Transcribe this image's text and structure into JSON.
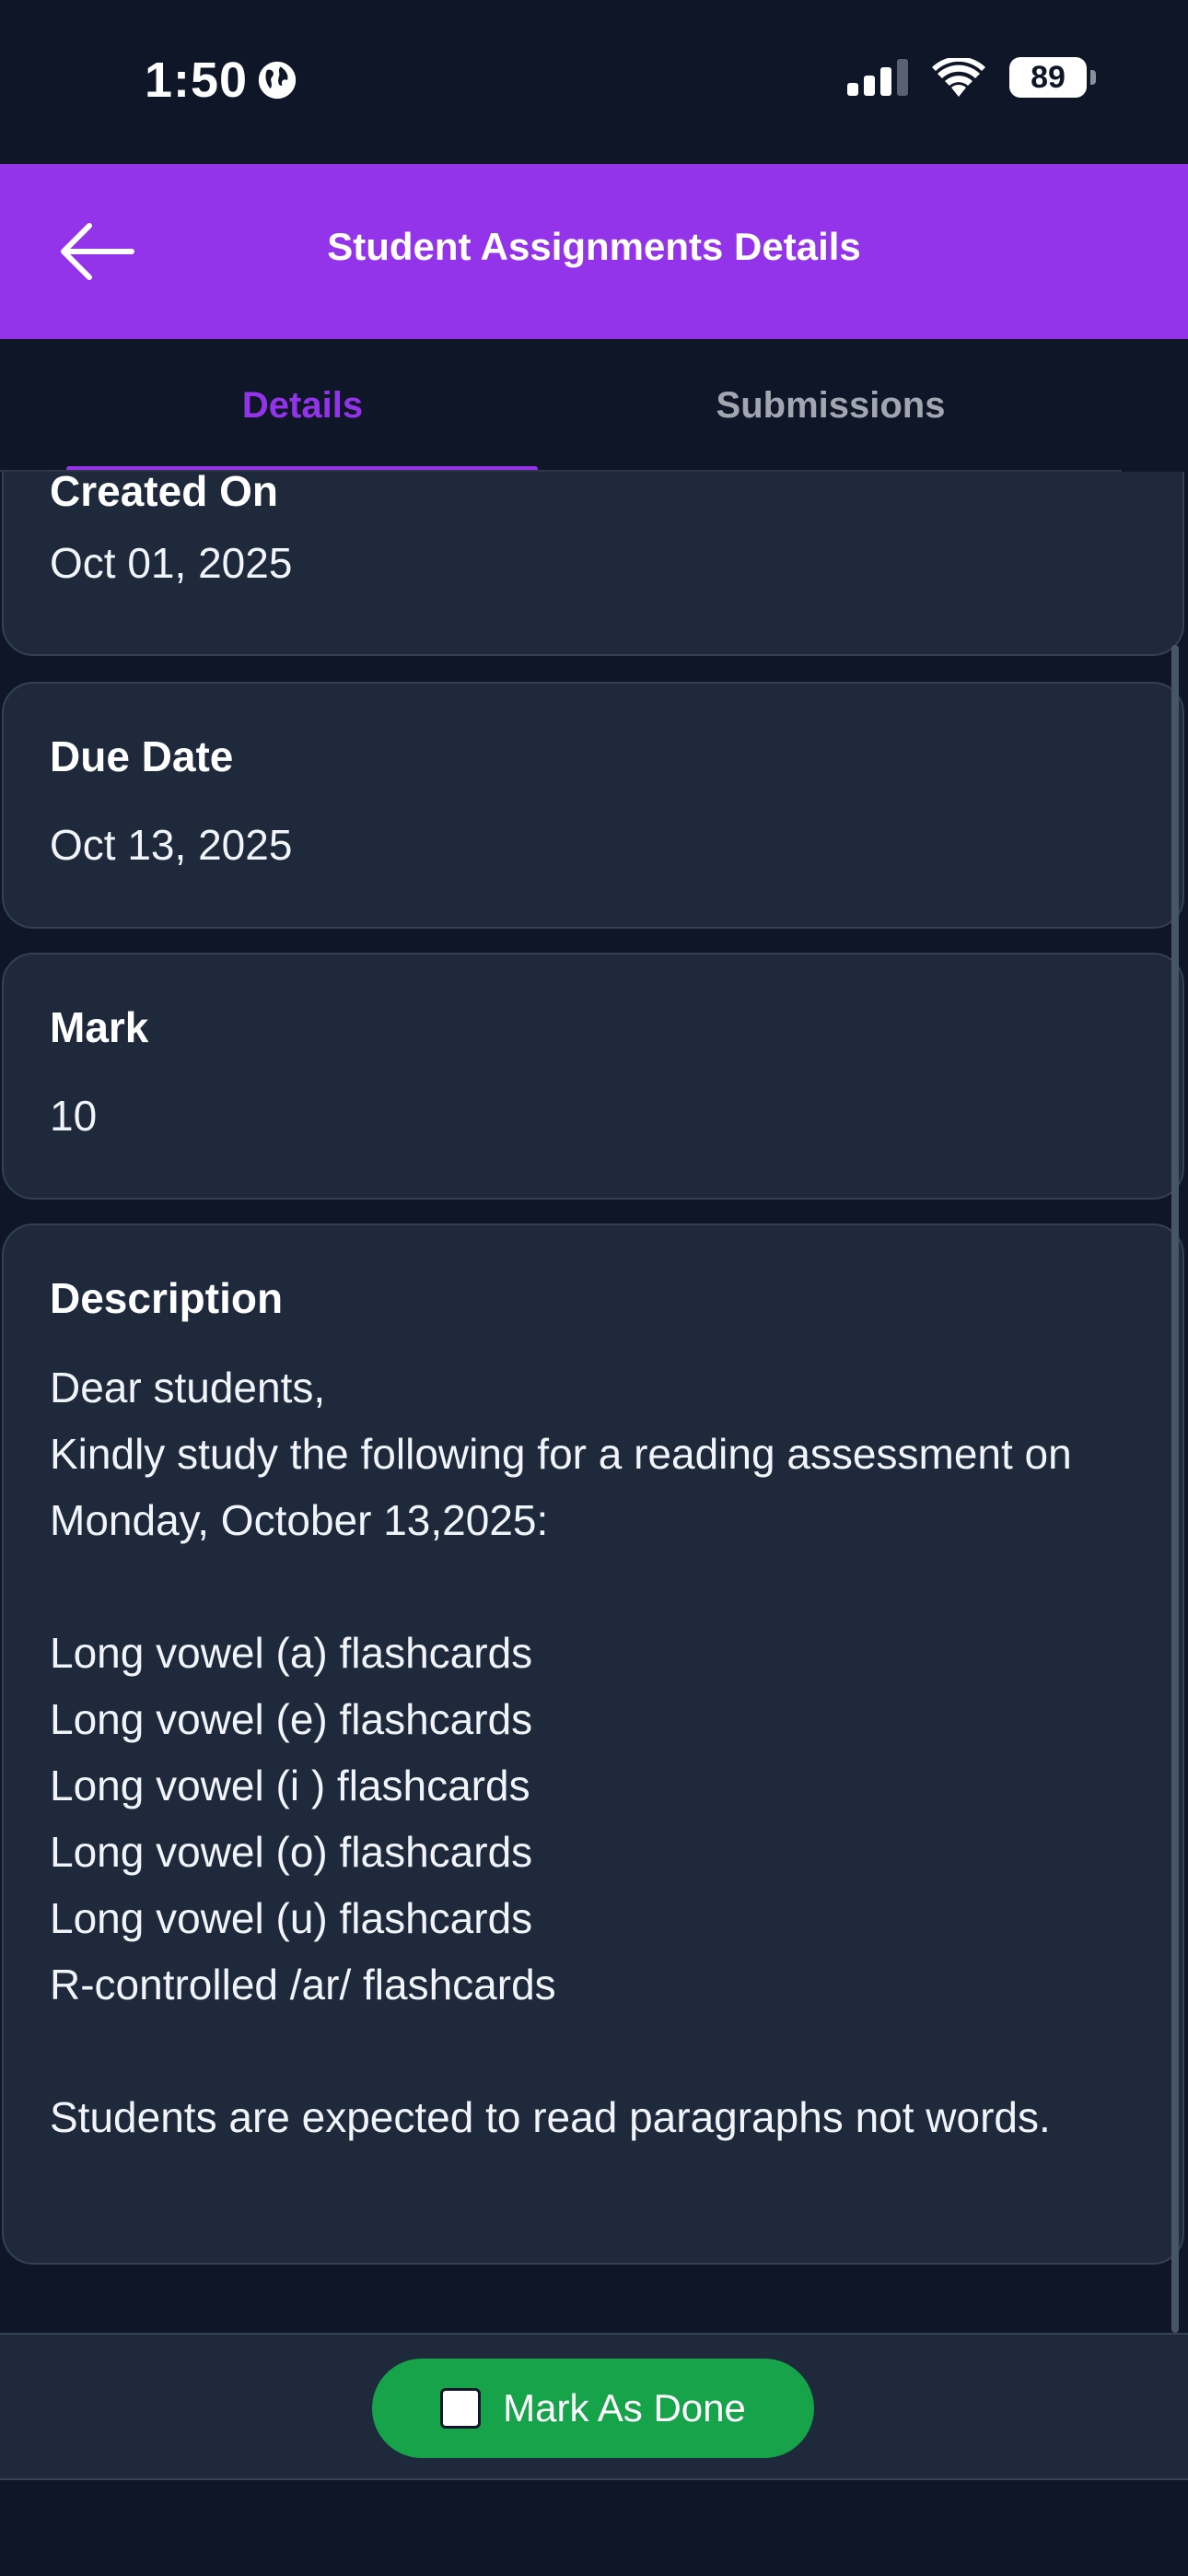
{
  "status_bar": {
    "time": "1:50",
    "battery": "89"
  },
  "header": {
    "title": "Student Assignments Details"
  },
  "tabs": [
    {
      "label": "Details",
      "active": true
    },
    {
      "label": "Submissions",
      "active": false
    }
  ],
  "fields": {
    "created_on": {
      "label": "Created On",
      "value": "Oct 01, 2025"
    },
    "due_date": {
      "label": "Due Date",
      "value": "Oct 13, 2025"
    },
    "mark": {
      "label": "Mark",
      "value": "10"
    },
    "description": {
      "label": "Description",
      "value": "Dear students,\nKindly study the following for a reading assessment on Monday, October 13,2025:\n\nLong vowel (a) flashcards\nLong vowel (e) flashcards\nLong vowel (i ) flashcards\nLong vowel (o) flashcards\nLong vowel (u) flashcards\nR-controlled /ar/ flashcards\n\nStudents are expected to read paragraphs not words."
    }
  },
  "footer": {
    "mark_done_label": "Mark As Done"
  },
  "colors": {
    "accent": "#9333ea",
    "background": "#0e1628",
    "card": "#1e293b",
    "success": "#16a34a"
  }
}
